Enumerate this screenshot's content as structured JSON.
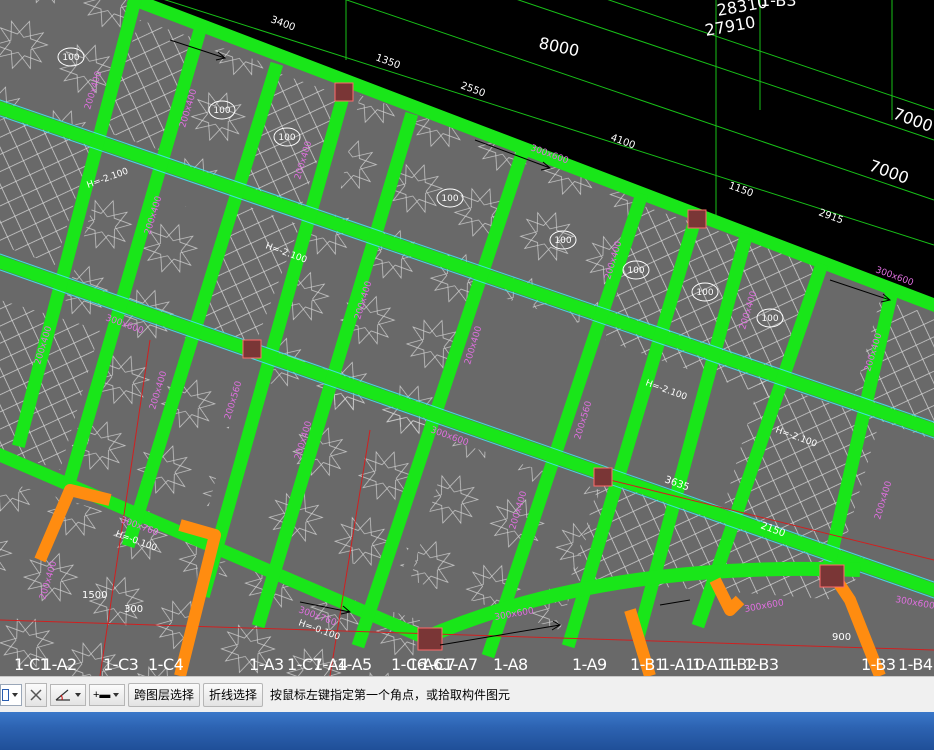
{
  "drawing": {
    "top_dimensions": {
      "d3400": "3400",
      "d1350": "1350",
      "d2550": "2550",
      "d4100": "4100",
      "d1150": "1150",
      "d2915": "2915",
      "d8000": "8000",
      "d27910": "27910",
      "d28310": "28310",
      "d7000a": "7000",
      "d7000b": "7000",
      "grid_b3": "1-B3"
    },
    "slab_thickness": "100",
    "beam_labels": {
      "b200x400": "200x400",
      "b300x600": "300x600",
      "b200x560": "200x560",
      "b300x760": "300x760"
    },
    "elevations": {
      "h_2100": "H=-2.100",
      "h_0100": "H=-0.100"
    },
    "small_dimensions": {
      "d3635": "3635",
      "d2150": "2150",
      "d1500": "1500",
      "d300": "300",
      "d900": "900"
    }
  },
  "grid_axis_labels": [
    "1-C1",
    "1-A2",
    "1-C3",
    "1-C4",
    "1-A3",
    "1-C7",
    "1-A4",
    "1-A5",
    "1-C6",
    "1-A6",
    "1-C7",
    "1-A7",
    "1-A8",
    "1-A9",
    "1-B1",
    "1-A10",
    "1-A11",
    "1-B2",
    "1-B3",
    "1-B3",
    "1-B4"
  ],
  "toolbar": {
    "cross_layer_select": "跨图层选择",
    "polyline_select": "折线选择",
    "prompt": "按鼠标左键指定第一个角点，或拾取构件图元"
  },
  "colors": {
    "background": "#000000",
    "slab": "#6b6b6b",
    "beam": "#19e619",
    "column": "#7a3a3a",
    "orange_wall": "#ff8c10",
    "dim_text": "#ffffff",
    "beam_text": "#e070e0"
  }
}
